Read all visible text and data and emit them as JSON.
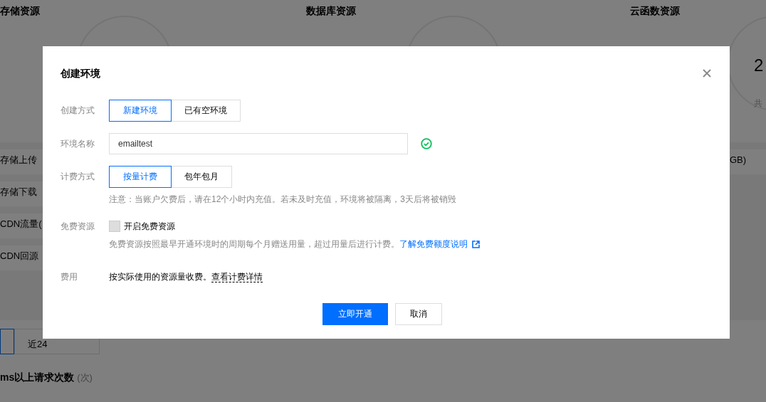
{
  "background": {
    "sections": [
      {
        "title": "存储资源"
      },
      {
        "title": "数据库资源"
      },
      {
        "title": "云函数资源"
      }
    ],
    "gauge_reading": "2",
    "gauge_caption": "共",
    "metrics": [
      "存储上传",
      "存储下载",
      "CDN流量(",
      "CDN回源"
    ],
    "right_unit": "GB)",
    "range_button": "近24",
    "section_title": "ms以上请求次数",
    "section_unit": "(次)"
  },
  "dialog": {
    "title": "创建环境",
    "fields": [
      {
        "kind": "segmented",
        "label": "创建方式",
        "options": [
          {
            "label": "新建环境",
            "selected": true
          },
          {
            "label": "已有空环境",
            "selected": false
          }
        ]
      },
      {
        "kind": "input",
        "label": "环境名称",
        "value": "emailtest",
        "valid": true
      },
      {
        "kind": "segmented",
        "label": "计费方式",
        "options": [
          {
            "label": "按量计费",
            "selected": true
          },
          {
            "label": "包年包月",
            "selected": false
          }
        ],
        "note": "注意：当账户欠费后，请在12个小时内充值。若未及时充值，环境将被隔离，3天后将被销毁"
      },
      {
        "kind": "checkbox",
        "label": "免费资源",
        "option": "开启免费资源",
        "checked": false,
        "note": "免费资源按照最早开通环境时的周期每个月赠送用量，超过用量后进行计费。",
        "link": "了解免费额度说明"
      },
      {
        "kind": "text",
        "label": "费用",
        "text": "按实际使用的资源量收费。",
        "link": "查看计费详情"
      }
    ],
    "buttons": [
      {
        "label": "立即开通",
        "primary": true
      },
      {
        "label": "取消",
        "primary": false
      }
    ]
  }
}
